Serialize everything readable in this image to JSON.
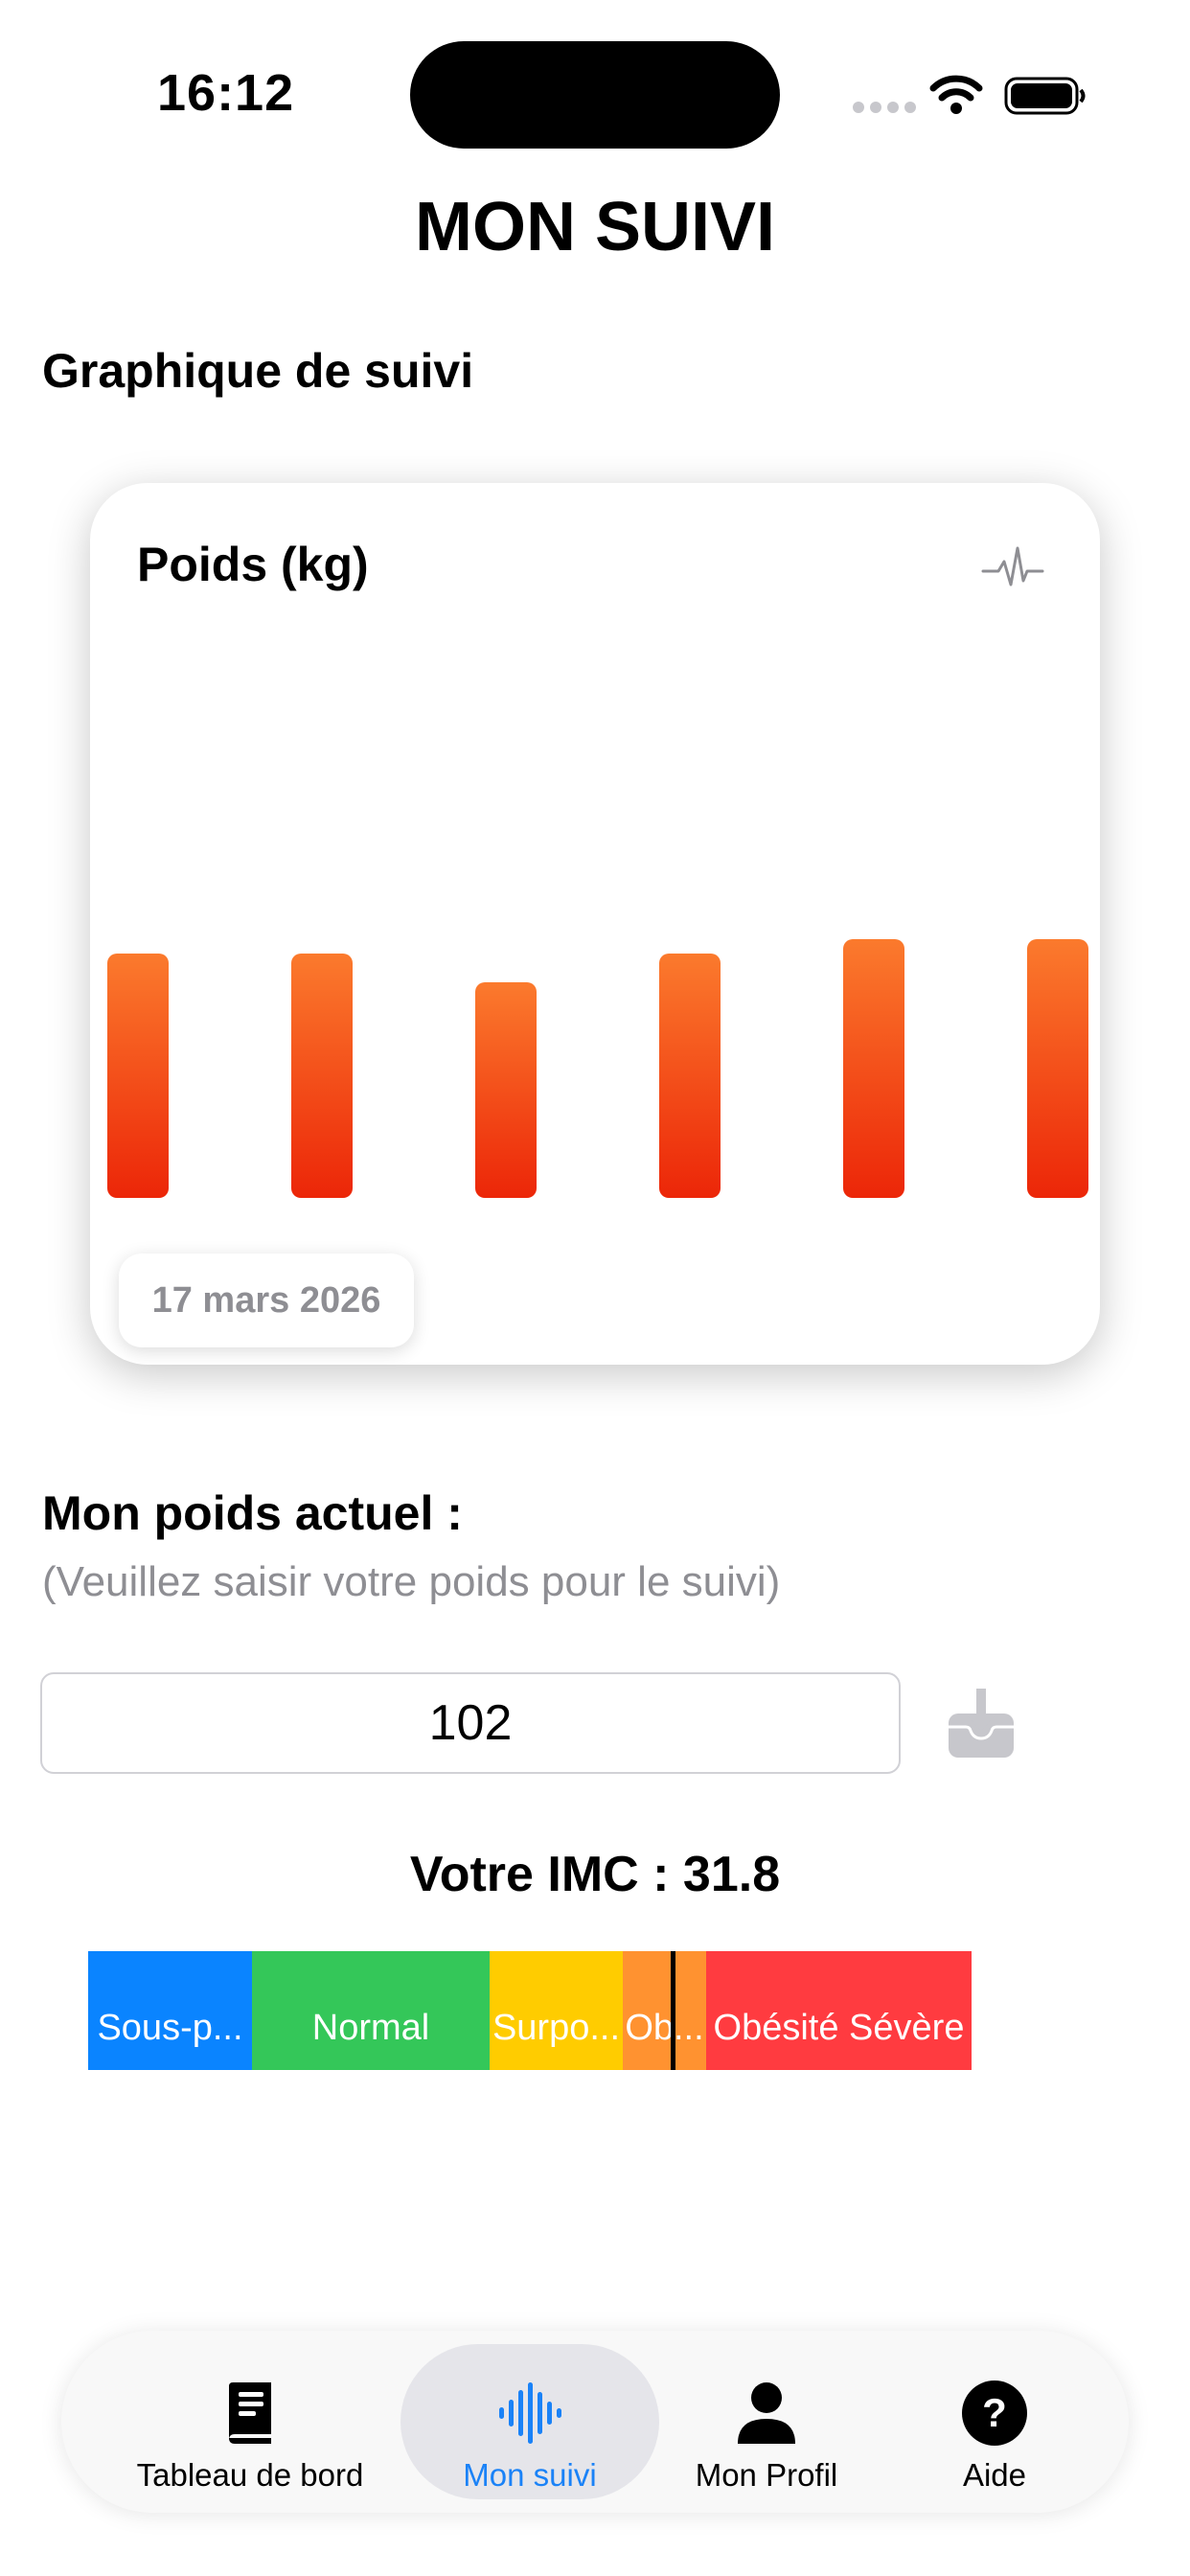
{
  "status_bar": {
    "time": "16:12"
  },
  "page": {
    "title": "MON SUIVI",
    "section_title": "Graphique de suivi"
  },
  "chart_card": {
    "title": "Poids (kg)",
    "icon": "heart-rate-waveform-icon",
    "tooltip_date": "17 mars 2026",
    "bar_gradient": [
      "#fb7a2d",
      "#ec2608"
    ]
  },
  "chart_data": {
    "type": "bar",
    "title": "Poids (kg)",
    "categories": [
      "",
      "",
      "",
      "",
      "",
      ""
    ],
    "values": [
      102,
      102,
      100,
      102,
      103,
      103
    ],
    "ylim": [
      0,
      105
    ],
    "grid": false,
    "selected_index": 0,
    "selected_label": "17 mars 2026"
  },
  "weight_form": {
    "label": "Mon poids actuel :",
    "hint": "(Veuillez saisir votre poids pour le suivi)",
    "value": "102",
    "save_icon": "tray-download-icon"
  },
  "imc": {
    "text": "Votre IMC : 31.8",
    "value": 31.8,
    "categories": [
      {
        "label": "Sous-p...",
        "color": "#0a84ff"
      },
      {
        "label": "Normal",
        "color": "#34c759"
      },
      {
        "label": "Surpo...",
        "color": "#ffcc00"
      },
      {
        "label": "Ob...",
        "color": "#ff9230"
      },
      {
        "label": "Obésité Sévère",
        "color": "#ff3b40"
      }
    ]
  },
  "tab_bar": {
    "active": "Mon suivi",
    "tabs": [
      {
        "label": "Tableau de bord",
        "icon": "book-icon"
      },
      {
        "label": "Mon suivi",
        "icon": "waveform-icon"
      },
      {
        "label": "Mon Profil",
        "icon": "person-icon"
      },
      {
        "label": "Aide",
        "icon": "question-circle-icon"
      }
    ],
    "active_color": "#1a82f7"
  }
}
